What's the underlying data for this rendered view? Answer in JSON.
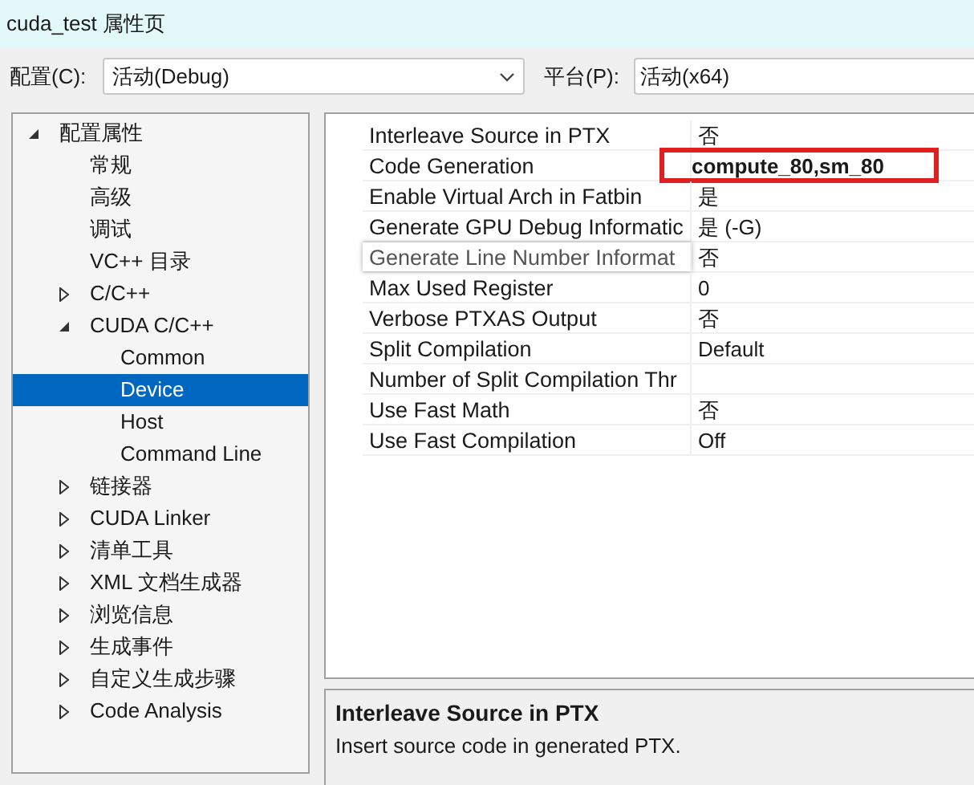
{
  "window": {
    "title": "cuda_test 属性页"
  },
  "toolbar": {
    "config_label": "配置(C):",
    "config_value": "活动(Debug)",
    "platform_label": "平台(P):",
    "platform_value": "活动(x64)"
  },
  "tree": [
    {
      "label": "配置属性",
      "expanded": true,
      "selected": false,
      "children": [
        {
          "label": "常规",
          "selected": false
        },
        {
          "label": "高级",
          "selected": false
        },
        {
          "label": "调试",
          "selected": false
        },
        {
          "label": "VC++ 目录",
          "selected": false
        },
        {
          "label": "C/C++",
          "expanded": false,
          "selected": false
        },
        {
          "label": "CUDA C/C++",
          "expanded": true,
          "selected": false,
          "children": [
            {
              "label": "Common",
              "selected": false
            },
            {
              "label": "Device",
              "selected": true
            },
            {
              "label": "Host",
              "selected": false
            },
            {
              "label": "Command Line",
              "selected": false
            }
          ]
        },
        {
          "label": "链接器",
          "expanded": false,
          "selected": false
        },
        {
          "label": "CUDA Linker",
          "expanded": false,
          "selected": false
        },
        {
          "label": "清单工具",
          "expanded": false,
          "selected": false
        },
        {
          "label": "XML 文档生成器",
          "expanded": false,
          "selected": false
        },
        {
          "label": "浏览信息",
          "expanded": false,
          "selected": false
        },
        {
          "label": "生成事件",
          "expanded": false,
          "selected": false
        },
        {
          "label": "自定义生成步骤",
          "expanded": false,
          "selected": false
        },
        {
          "label": "Code Analysis",
          "expanded": false,
          "selected": false
        }
      ]
    }
  ],
  "properties": [
    {
      "name": "Interleave Source in PTX",
      "value": "否",
      "bold": false,
      "highlighted": false,
      "tooltip": false
    },
    {
      "name": "Code Generation",
      "value": "compute_80,sm_80",
      "bold": true,
      "highlighted": true,
      "tooltip": false
    },
    {
      "name": "Enable Virtual Arch in Fatbin",
      "value": "是",
      "bold": false,
      "highlighted": false,
      "tooltip": false
    },
    {
      "name": "Generate GPU Debug Informatic",
      "value": "是 (-G)",
      "bold": false,
      "highlighted": false,
      "tooltip": false
    },
    {
      "name": "Generate Line Number Informat",
      "value": "否",
      "bold": false,
      "highlighted": false,
      "tooltip": true
    },
    {
      "name": "Max Used Register",
      "value": "0",
      "bold": false,
      "highlighted": false,
      "tooltip": false
    },
    {
      "name": "Verbose PTXAS Output",
      "value": "否",
      "bold": false,
      "highlighted": false,
      "tooltip": false
    },
    {
      "name": "Split Compilation",
      "value": "Default",
      "bold": false,
      "highlighted": false,
      "tooltip": false
    },
    {
      "name": "Number of Split Compilation Thr",
      "bold": false,
      "highlighted": false,
      "tooltip": false
    },
    {
      "name": "Use Fast Math",
      "value": "否",
      "bold": false,
      "highlighted": false,
      "tooltip": false
    },
    {
      "name": "Use Fast Compilation",
      "value": "Off",
      "bold": false,
      "highlighted": false,
      "tooltip": false
    }
  ],
  "description": {
    "title": "Interleave Source in PTX",
    "text": "Insert source code in generated PTX."
  }
}
